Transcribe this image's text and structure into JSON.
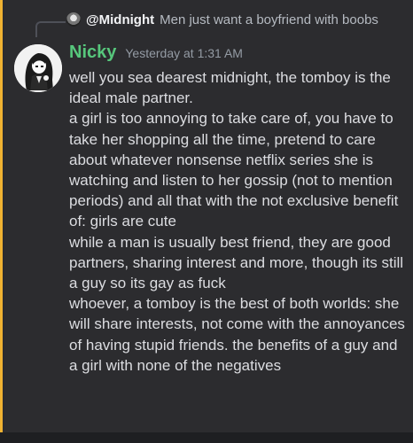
{
  "reply": {
    "author": "@Midnight",
    "text": "Men just want a boyfriend with boobs"
  },
  "message": {
    "author": "Nicky",
    "timestamp": "Yesterday at 1:31 AM",
    "paragraphs": [
      "well you sea dearest midnight, the tomboy is the ideal male partner.",
      "a girl is too annoying to take care of, you have to take her shopping all the time, pretend to care about whatever nonsense netflix series she is watching and listen to her gossip (not to mention periods) and all that with the not exclusive benefit of: girls are cute",
      "while a man is usually best friend, they are good partners, sharing interest and more, though its still a guy so its gay as fuck",
      "whoever, a tomboy is the best of both worlds: she will share interests, not come with the annoyances of having stupid friends. the benefits of a guy and a girl with none of the negatives"
    ]
  },
  "colors": {
    "username": "#57c77c",
    "accent_bar": "#f0b232",
    "background": "#2c2c2f"
  },
  "icons": {
    "reply_avatar": "user-avatar-small-icon",
    "avatar": "anime-character-avatar"
  }
}
